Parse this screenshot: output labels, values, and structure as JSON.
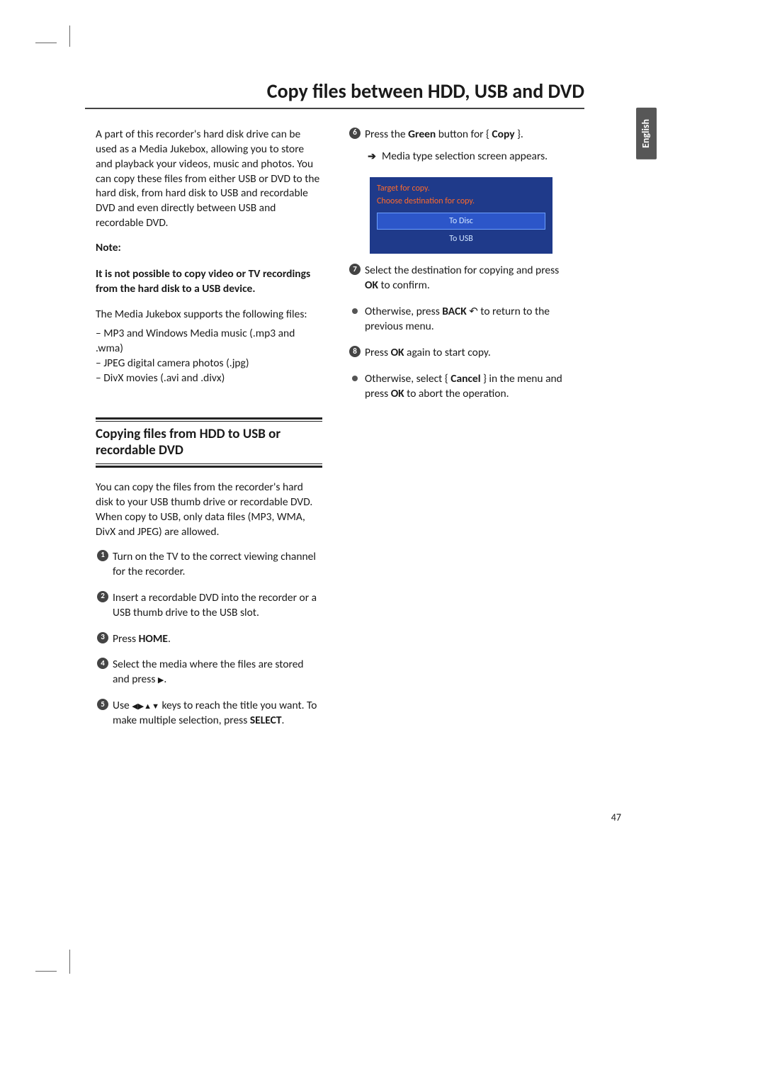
{
  "page_number": "47",
  "language_tab": "English",
  "title": "Copy files between HDD, USB and DVD",
  "left": {
    "intro": "A part of this recorder's hard disk drive can be used as a Media Jukebox, allowing you to store and playback your videos, music and photos.  You can copy these files from either USB or DVD to the hard disk, from hard disk to USB and recordable DVD and even directly between USB and recordable DVD.",
    "note_label": "Note:",
    "note_bold": "It is not possible to copy video or TV recordings from the hard disk to a USB device.",
    "supports_line": "The Media Jukebox supports the following files:",
    "files": [
      "MP3 and Windows Media music (.mp3 and .wma)",
      "JPEG digital camera photos (.jpg)",
      "DivX movies (.avi and .divx)"
    ],
    "section_head": "Copying files from HDD to USB or recordable DVD",
    "section_intro": "You can copy the files from the recorder's hard disk to your USB thumb drive or recordable DVD.  When copy to USB, only data files (MP3, WMA, DivX and JPEG) are allowed.",
    "steps": {
      "s1": "Turn on the TV to the correct viewing channel for the recorder.",
      "s2": "Insert a recordable DVD into the recorder or a USB thumb drive to the USB slot.",
      "s3_pre": "Press ",
      "s3_bold": "HOME",
      "s3_post": ".",
      "s4_pre": "Select the media where the files are stored and press ",
      "s4_post": ".",
      "s5_pre": "Use ",
      "s5_mid": " keys to reach the title you want.  To make multiple selection, press ",
      "s5_bold": "SELECT",
      "s5_post": "."
    }
  },
  "right": {
    "s6_pre": "Press the ",
    "s6_green": "Green",
    "s6_mid": " button for { ",
    "s6_copy": "Copy",
    "s6_post": " }.",
    "s6_arrow": "Media type selection screen appears.",
    "screenshot": {
      "title": "Target for copy.",
      "subtitle": "Choose destination for copy.",
      "opt1": "To Disc",
      "opt2": "To USB"
    },
    "s7_pre": "Select the destination for copying and press ",
    "s7_ok": "OK",
    "s7_post": " to confirm.",
    "b1_pre": "Otherwise, press ",
    "b1_back": "BACK",
    "b1_post": " to return to the previous menu.",
    "s8_pre": "Press ",
    "s8_ok": "OK",
    "s8_post": " again to start copy.",
    "b2_pre": "Otherwise, select { ",
    "b2_cancel": "Cancel",
    "b2_mid": " } in the menu and press ",
    "b2_ok": "OK",
    "b2_post": " to abort the operation."
  }
}
